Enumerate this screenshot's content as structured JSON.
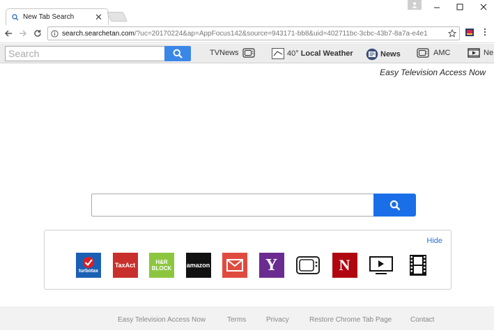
{
  "browser": {
    "tab_title": "New Tab Search",
    "tab_close": "✕",
    "url_host": "search.searchetan.com",
    "url_rest": "/?uc=20170224&ap=AppFocus142&source=943171-bb8&uid=402711bc-3cbc-43b7-8a7a-e4e1"
  },
  "extbar": {
    "search_placeholder": "Search",
    "tvnews": "TVNews",
    "weather_temp": "40°",
    "weather_label": "Local Weather",
    "news": "News",
    "amc": "AMC",
    "ne": "Ne"
  },
  "tagline": "Easy Television Access Now",
  "shortcuts": {
    "hide": "Hide",
    "turbotax": "turbotax",
    "taxact": "TaxAct",
    "hrblock_1": "H&R",
    "hrblock_2": "BLOCK",
    "amazon": "amazon",
    "yahoo": "Y",
    "netflix": "N"
  },
  "footer": {
    "brand": "Easy Television Access Now",
    "terms": "Terms",
    "privacy": "Privacy",
    "restore": "Restore Chrome Tab Page",
    "contact": "Contact"
  },
  "colors": {
    "accent_blue": "#1a6fe8",
    "ext_search_blue": "#3b87e8",
    "link_blue": "#2a6fcf"
  }
}
